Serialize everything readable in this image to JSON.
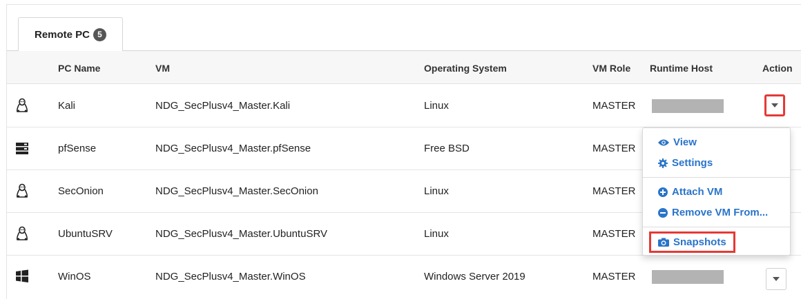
{
  "tab": {
    "label": "Remote PC",
    "count": "5"
  },
  "columns": {
    "pc_name": "PC Name",
    "vm": "VM",
    "os": "Operating System",
    "vm_role": "VM Role",
    "runtime_host": "Runtime Host",
    "action": "Action"
  },
  "rows": [
    {
      "icon": "linux-icon",
      "pc_name": "Kali",
      "vm": "NDG_SecPlusv4_Master.Kali",
      "os": "Linux",
      "role": "MASTER"
    },
    {
      "icon": "server-icon",
      "pc_name": "pfSense",
      "vm": "NDG_SecPlusv4_Master.pfSense",
      "os": "Free BSD",
      "role": "MASTER"
    },
    {
      "icon": "linux-icon",
      "pc_name": "SecOnion",
      "vm": "NDG_SecPlusv4_Master.SecOnion",
      "os": "Linux",
      "role": "MASTER"
    },
    {
      "icon": "linux-icon",
      "pc_name": "UbuntuSRV",
      "vm": "NDG_SecPlusv4_Master.UbuntuSRV",
      "os": "Linux",
      "role": "MASTER"
    },
    {
      "icon": "windows-icon",
      "pc_name": "WinOS",
      "vm": "NDG_SecPlusv4_Master.WinOS",
      "os": "Windows Server 2019",
      "role": "MASTER"
    }
  ],
  "menu": {
    "view": "View",
    "settings": "Settings",
    "attach_vm": "Attach VM",
    "remove_vm": "Remove VM From...",
    "snapshots": "Snapshots"
  },
  "colors": {
    "link": "#2a74c9",
    "highlight": "#e53935",
    "redacted": "#b3b3b3"
  }
}
